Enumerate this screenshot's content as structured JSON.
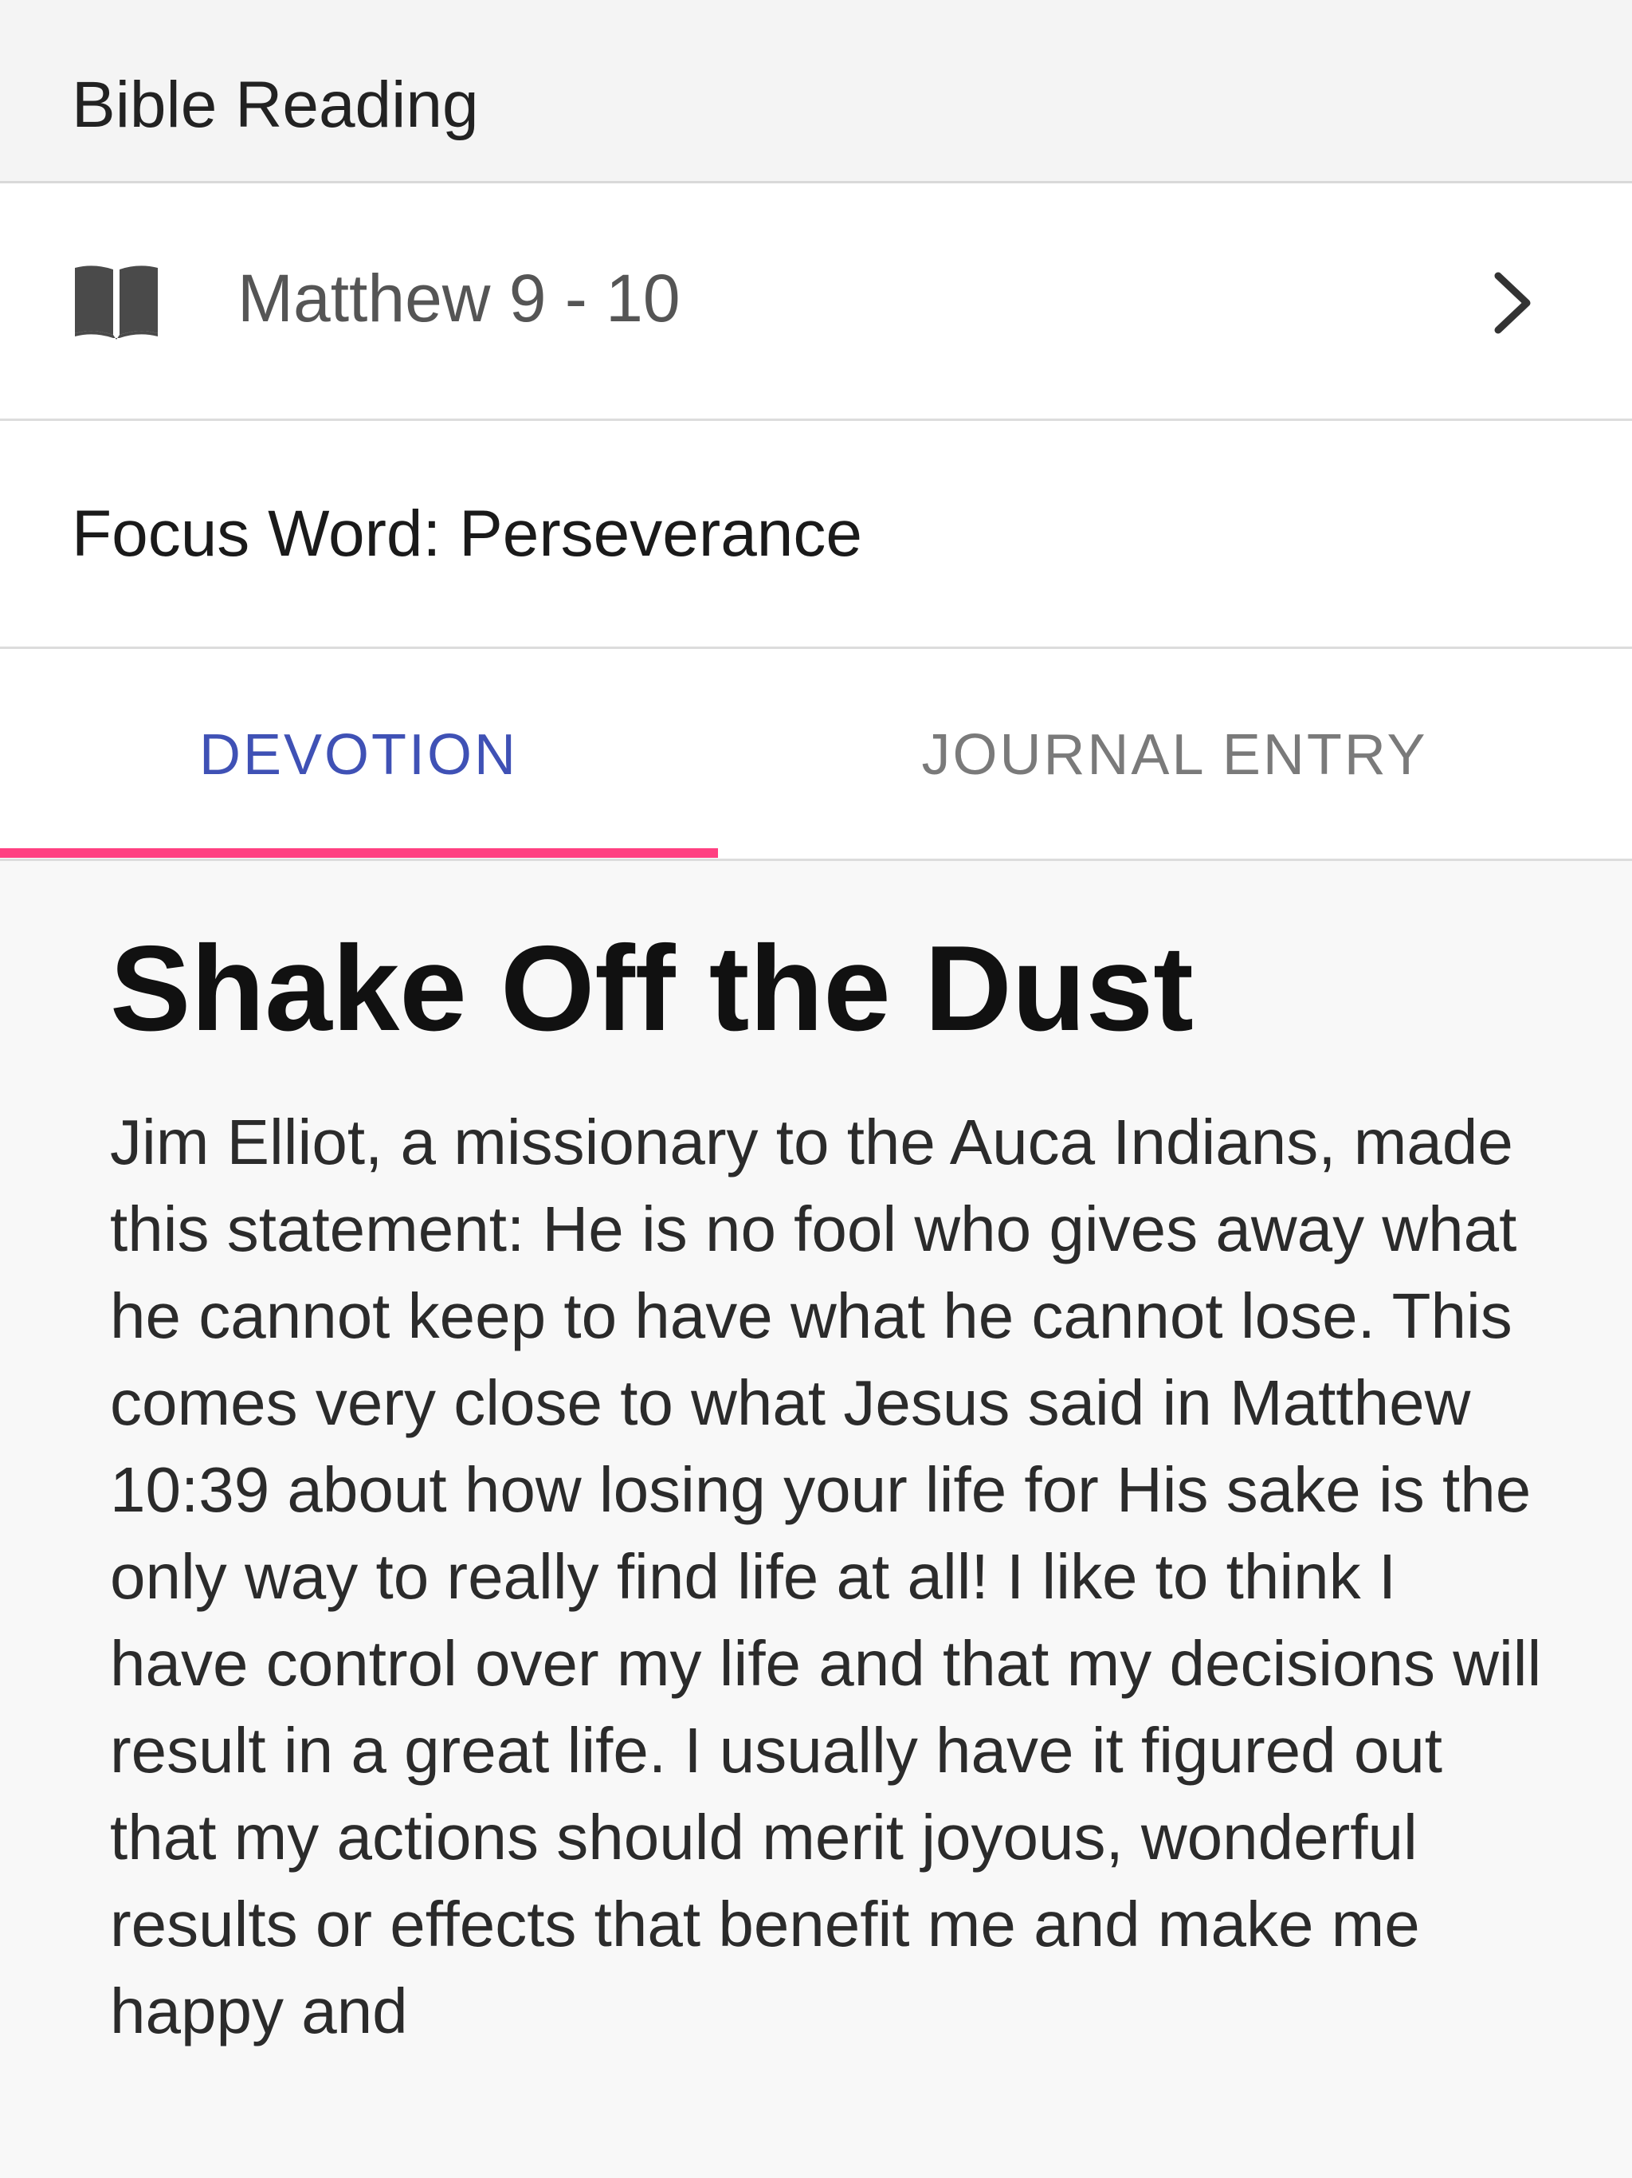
{
  "header": {
    "title": "Bible Reading"
  },
  "reading": {
    "passage": "Matthew 9 - 10",
    "icon": "book-icon",
    "chevron": "chevron-right-icon"
  },
  "focus": {
    "text": "Focus Word: Perseverance"
  },
  "tabs": [
    {
      "label": "DEVOTION",
      "active": true
    },
    {
      "label": "JOURNAL ENTRY",
      "active": false
    }
  ],
  "colors": {
    "active_tab": "#3f51b5",
    "inactive_tab": "#7a7a7a",
    "indicator": "#ff4081"
  },
  "devotion": {
    "title": "Shake Off the Dust",
    "body": "Jim Elliot, a missionary to the Auca Indians, made this statement: He is no fool who gives away what he cannot keep to have what he cannot lose. This comes very close to what Jesus said in Matthew 10:39 about how losing your life for His sake is the only way to really find life at all! I like to think I have control over my life and that my decisions will result in a great life. I usually have it figured out that my actions should merit joyous, wonderful results or effects that benefit me and make me happy and"
  }
}
